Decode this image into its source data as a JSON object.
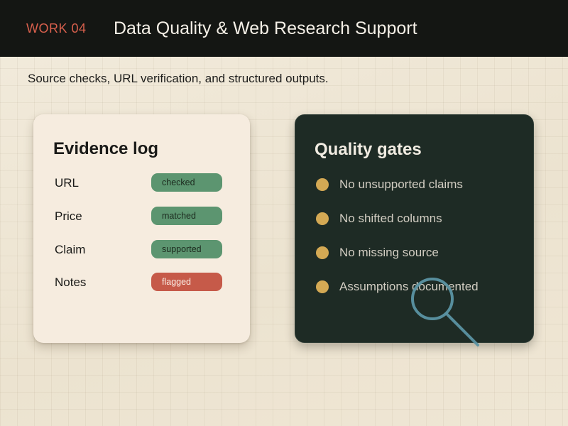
{
  "header": {
    "tag": "WORK 04",
    "title": "Data Quality & Web Research Support"
  },
  "subtitle": "Source checks, URL verification, and structured outputs.",
  "evidence_log": {
    "title": "Evidence log",
    "rows": [
      {
        "label": "URL",
        "status": "checked",
        "state": "ok"
      },
      {
        "label": "Price",
        "status": "matched",
        "state": "ok"
      },
      {
        "label": "Claim",
        "status": "supported",
        "state": "ok"
      },
      {
        "label": "Notes",
        "status": "flagged",
        "state": "flagged"
      }
    ]
  },
  "quality_gates": {
    "title": "Quality gates",
    "items": [
      "No unsupported claims",
      "No shifted columns",
      "No missing source",
      "Assumptions documented"
    ]
  },
  "colors": {
    "accent_red": "#d9604d",
    "status_ok": "#5c9570",
    "status_flagged": "#c65a49",
    "gate_dot": "#d4a954",
    "dark_card": "#1e2b25",
    "topbar": "#141613"
  },
  "icons": {
    "decoration": "magnifier-icon"
  }
}
